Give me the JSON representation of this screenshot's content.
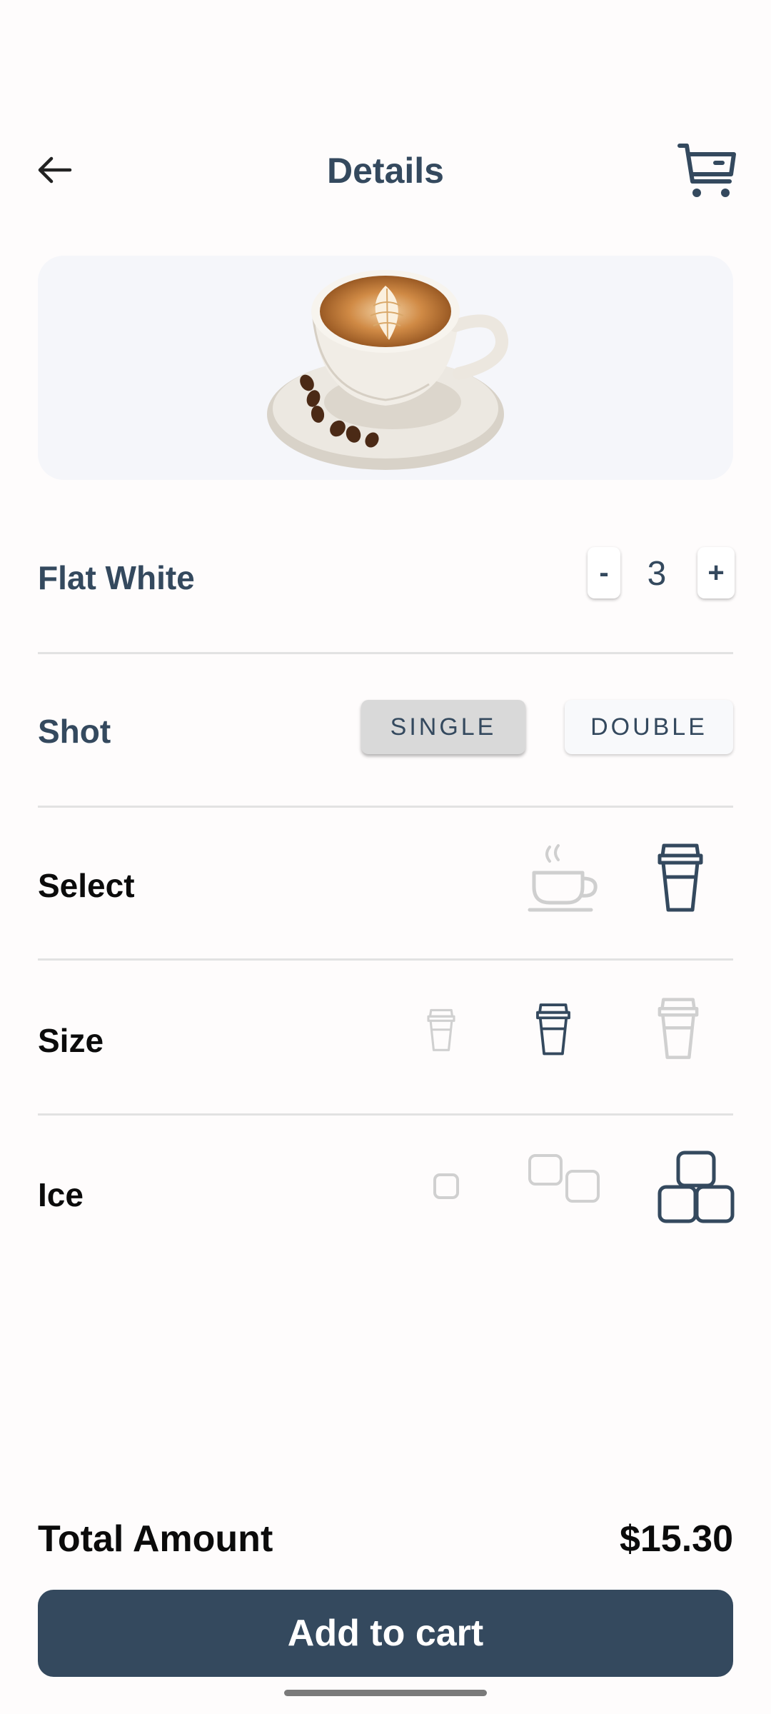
{
  "header": {
    "title": "Details"
  },
  "product": {
    "name": "Flat White",
    "quantity": "3",
    "minus_label": "-",
    "plus_label": "+"
  },
  "shot": {
    "label": "Shot",
    "options": [
      "SINGLE",
      "DOUBLE"
    ],
    "selected": "SINGLE"
  },
  "select": {
    "label": "Select",
    "icons": [
      "hot-cup-icon",
      "takeaway-cup-icon"
    ],
    "selected": "takeaway-cup-icon"
  },
  "size": {
    "label": "Size",
    "icons": [
      "small-cup-icon",
      "medium-cup-icon",
      "large-cup-icon"
    ],
    "selected": "medium-cup-icon"
  },
  "ice": {
    "label": "Ice",
    "icons": [
      "one-ice-cube-icon",
      "two-ice-cubes-icon",
      "three-ice-cubes-icon"
    ],
    "selected": "three-ice-cubes-icon"
  },
  "footer": {
    "total_label": "Total Amount",
    "total_amount": "$15.30",
    "add_to_cart_label": "Add to cart"
  },
  "colors": {
    "primary": "#34495e",
    "hero_bg": "#f5f6fa",
    "inactive_icon": "#d0d0d0",
    "chip_selected": "#d9d9d9"
  }
}
